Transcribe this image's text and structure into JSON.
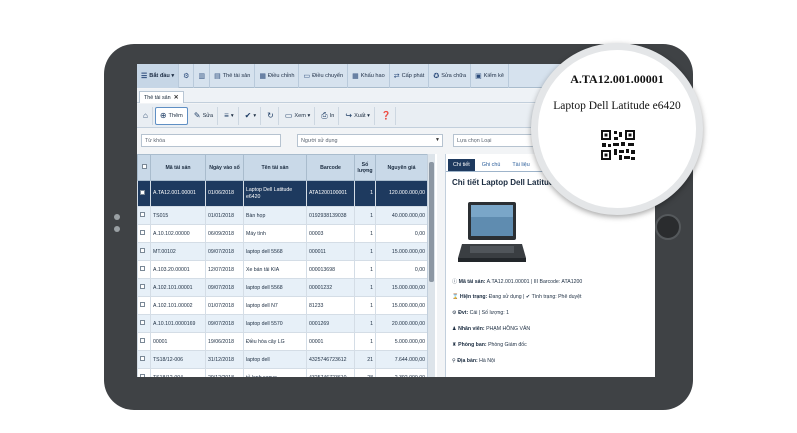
{
  "menubar": {
    "items": [
      {
        "label": "Bắt đầu ▾",
        "icon": "menu-icon"
      },
      {
        "label": "",
        "icon": "dashboard-icon"
      },
      {
        "label": "",
        "icon": "chart-icon"
      },
      {
        "label": "Thẻ tài sản",
        "icon": "card-icon"
      },
      {
        "label": "Điều chỉnh",
        "icon": "adjust-icon"
      },
      {
        "label": "Điều chuyển",
        "icon": "transfer-icon"
      },
      {
        "label": "Khấu hao",
        "icon": "depreciation-icon"
      },
      {
        "label": "Cấp phát",
        "icon": "allocate-icon"
      },
      {
        "label": "Sửa chữa",
        "icon": "repair-icon"
      },
      {
        "label": "Kiểm kê",
        "icon": "inventory-icon"
      }
    ]
  },
  "tabs": [
    {
      "label": "Thẻ tài sản",
      "close": "✕"
    }
  ],
  "toolbar": {
    "add_label": "Thêm",
    "edit_label": "Sửa",
    "view_label": "Xem ▾",
    "print_label": "In",
    "export_label": "Xuất ▾",
    "list_label": "▾",
    "check_label": "▾"
  },
  "filters": {
    "keyword_placeholder": "Từ khóa",
    "user_placeholder": "Người sử dụng",
    "type_placeholder": "Lựa chọn Loại"
  },
  "table": {
    "headers": [
      "Mã tài sản",
      "Ngày vào sổ",
      "Tên tài sản",
      "Barcode",
      "Số lượng",
      "Nguyên giá"
    ],
    "rows": [
      {
        "code": "A.TA12.001.00001",
        "date": "01/06/2018",
        "name": "Laptop Dell Latitude e6420",
        "barcode": "ATA1200100001",
        "qty": "1",
        "price": "120.000.000,00",
        "selected": true
      },
      {
        "code": "TS015",
        "date": "01/01/2018",
        "name": "Bàn họp",
        "barcode": "0192938139038",
        "qty": "1",
        "price": "40.000.000,00"
      },
      {
        "code": "A.10.102.00000",
        "date": "06/09/2018",
        "name": "Máy tính",
        "barcode": "00003",
        "qty": "1",
        "price": "0,00"
      },
      {
        "code": "MT.00102",
        "date": "09/07/2018",
        "name": "laptop dell 5568",
        "barcode": "000011",
        "qty": "1",
        "price": "15.000.000,00"
      },
      {
        "code": "A.103.20.00001",
        "date": "12/07/2018",
        "name": "Xe bán tải KIA",
        "barcode": "000013698",
        "qty": "1",
        "price": "0,00"
      },
      {
        "code": "A.102.101.00001",
        "date": "09/07/2018",
        "name": "laptop dell 5568",
        "barcode": "00001232",
        "qty": "1",
        "price": "15.000.000,00"
      },
      {
        "code": "A.102.101.00002",
        "date": "01/07/2018",
        "name": "laptop dell N7",
        "barcode": "81233",
        "qty": "1",
        "price": "15.000.000,00"
      },
      {
        "code": "A.10.101.0000169",
        "date": "09/07/2018",
        "name": "laptop dell 5570",
        "barcode": "0001269",
        "qty": "1",
        "price": "20.000.000,00"
      },
      {
        "code": "00001",
        "date": "19/06/2018",
        "name": "Điều hòa cây LG",
        "barcode": "00001",
        "qty": "1",
        "price": "5.000.000,00"
      },
      {
        "code": "TS18/12-006",
        "date": "31/12/2018",
        "name": "laptop dell",
        "barcode": "4325746723612",
        "qty": "21",
        "price": "7.644.000,00"
      },
      {
        "code": "TS18/12-004",
        "date": "29/12/2018",
        "name": "tủ lạnh sanyo",
        "barcode": "4325746723610",
        "qty": "28",
        "price": "2.392.000,00"
      }
    ]
  },
  "detail": {
    "tabs": [
      "Chi tiết",
      "Ghi chú",
      "Tài liệu"
    ],
    "title": "Chi tiết Laptop Dell Latitude e6420",
    "title_short": "Laptop Dell Latitude e6420",
    "lines": [
      {
        "label": "Mã tài sản:",
        "value": " A.TA12.001.00001 | III Barcode: ATA1200"
      },
      {
        "label": "Hiện trạng:",
        "value": " Đang sử dụng | ✔ Tình trạng: Phê duyệt"
      },
      {
        "label": "Đvt:",
        "value": " Cái | Số lượng: 1"
      },
      {
        "label": "Nhân viên:",
        "value": " PHẠM HỒNG VÂN"
      },
      {
        "label": "Phòng ban:",
        "value": " Phòng Giám đốc"
      },
      {
        "label": "Địa bàn:",
        "value": " Hà Nội"
      }
    ]
  },
  "magnifier": {
    "code": "A.TA12.001.00001",
    "name": "Laptop Dell Latitude e6420"
  },
  "colors": {
    "accent": "#1e3a5f",
    "menubar": "#d6e2ee",
    "row_alt": "#e7f0f8",
    "tablet_bezel": "#3f4245"
  }
}
